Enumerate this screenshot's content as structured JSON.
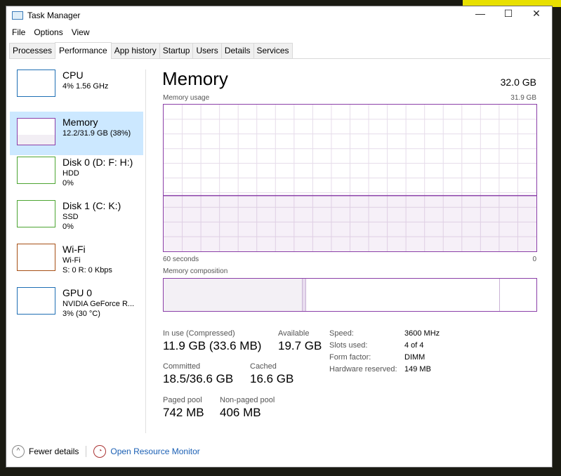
{
  "window": {
    "title": "Task Manager",
    "controls": [
      "—",
      "☐",
      "✕"
    ]
  },
  "menu": [
    "File",
    "Options",
    "View"
  ],
  "tabs": [
    "Processes",
    "Performance",
    "App history",
    "Startup",
    "Users",
    "Details",
    "Services"
  ],
  "active_tab": "Performance",
  "sidebar": [
    {
      "name": "CPU",
      "l1": "4% 1.56 GHz",
      "l2": "",
      "color": "#1f6fb4"
    },
    {
      "name": "Memory",
      "l1": "12.2/31.9 GB (38%)",
      "l2": "",
      "color": "#8b3fa8"
    },
    {
      "name": "Disk 0 (D: F: H:)",
      "l1": "HDD",
      "l2": "0%",
      "color": "#4da532"
    },
    {
      "name": "Disk 1 (C: K:)",
      "l1": "SSD",
      "l2": "0%",
      "color": "#4da532"
    },
    {
      "name": "Wi-Fi",
      "l1": "Wi-Fi",
      "l2": "S: 0 R: 0 Kbps",
      "color": "#a74f15"
    },
    {
      "name": "GPU 0",
      "l1": "NVIDIA GeForce R...",
      "l2": "3% (30 °C)",
      "color": "#1f6fb4"
    }
  ],
  "main": {
    "title": "Memory",
    "total": "32.0 GB",
    "usage_label": "Memory usage",
    "usage_max": "31.9 GB",
    "time_left": "60 seconds",
    "time_right": "0",
    "usage_percent": 38,
    "composition_label": "Memory composition",
    "composition_gb": {
      "in_use": 11.9,
      "modified": 0.3,
      "standby": 16.6,
      "free": 3.1
    },
    "stats": [
      {
        "k": "In use (Compressed)",
        "v": "11.9 GB (33.6 MB)"
      },
      {
        "k": "Available",
        "v": "19.7 GB"
      },
      {
        "k": "Committed",
        "v": "18.5/36.6 GB"
      },
      {
        "k": "Cached",
        "v": "16.6 GB"
      },
      {
        "k": "Paged pool",
        "v": "742 MB"
      },
      {
        "k": "Non-paged pool",
        "v": "406 MB"
      }
    ],
    "specs": [
      {
        "k": "Speed:",
        "v": "3600 MHz"
      },
      {
        "k": "Slots used:",
        "v": "4 of 4"
      },
      {
        "k": "Form factor:",
        "v": "DIMM"
      },
      {
        "k": "Hardware reserved:",
        "v": "149 MB"
      }
    ]
  },
  "footer": {
    "fewer": "Fewer details",
    "monitor": "Open Resource Monitor"
  }
}
